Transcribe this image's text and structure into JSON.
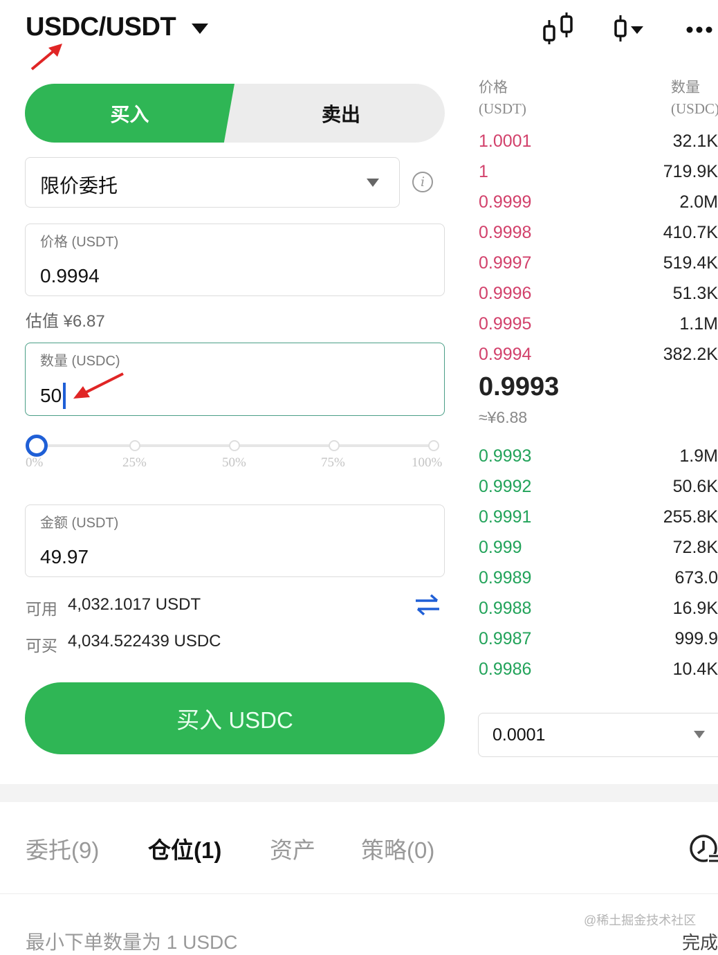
{
  "header": {
    "pair": "USDC/USDT",
    "icons": [
      "candlestick-chart-icon",
      "candle-dropdown-icon",
      "more-icon"
    ]
  },
  "trade_tabs": {
    "buy": "买入",
    "sell": "卖出",
    "active": "buy"
  },
  "order_type": {
    "value": "限价委托",
    "options_icon": "chevron-down-icon",
    "help_icon": "info-icon"
  },
  "price_field": {
    "label": "价格 (USDT)",
    "value": "0.9994"
  },
  "estimate": "估值 ¥6.87",
  "quantity_field": {
    "label": "数量 (USDC)",
    "value": "50"
  },
  "slider": {
    "labels": [
      "0%",
      "25%",
      "50%",
      "75%",
      "100%"
    ],
    "value_percent": 0
  },
  "amount_field": {
    "label": "金额 (USDT)",
    "value": "49.97"
  },
  "balances": {
    "available_key": "可用",
    "available_value": "4,032.1017 USDT",
    "buyable_key": "可买",
    "buyable_value": "4,034.522439 USDC"
  },
  "buy_button": "买入 USDC",
  "order_book": {
    "price_header": "价格",
    "price_unit": "(USDT)",
    "qty_header": "数量",
    "qty_unit": "(USDC)",
    "asks": [
      {
        "price": "1.0001",
        "qty": "32.1K"
      },
      {
        "price": "1",
        "qty": "719.9K"
      },
      {
        "price": "0.9999",
        "qty": "2.0M"
      },
      {
        "price": "0.9998",
        "qty": "410.7K"
      },
      {
        "price": "0.9997",
        "qty": "519.4K"
      },
      {
        "price": "0.9996",
        "qty": "51.3K"
      },
      {
        "price": "0.9995",
        "qty": "1.1M"
      },
      {
        "price": "0.9994",
        "qty": "382.2K"
      }
    ],
    "last_price": "0.9993",
    "last_price_cny": "≈¥6.88",
    "bids": [
      {
        "price": "0.9993",
        "qty": "1.9M"
      },
      {
        "price": "0.9992",
        "qty": "50.6K"
      },
      {
        "price": "0.9991",
        "qty": "255.8K"
      },
      {
        "price": "0.999",
        "qty": "72.8K"
      },
      {
        "price": "0.9989",
        "qty": "673.0"
      },
      {
        "price": "0.9988",
        "qty": "16.9K"
      },
      {
        "price": "0.9987",
        "qty": "999.9"
      },
      {
        "price": "0.9986",
        "qty": "10.4K"
      }
    ],
    "precision": "0.0001"
  },
  "bottom_tabs": [
    "委托(9)",
    "仓位(1)",
    "资产",
    "策略(0)"
  ],
  "active_bottom_tab": "仓位(1)",
  "min_order_notice": "最小下单数量为 1 USDC",
  "watermark": "@稀土掘金技术社区",
  "done_text": "完成",
  "colors": {
    "buy_green": "#2fb655",
    "ask_red": "#d2416b",
    "bid_green": "#22a35a",
    "focus_blue": "#1f5fd6"
  }
}
